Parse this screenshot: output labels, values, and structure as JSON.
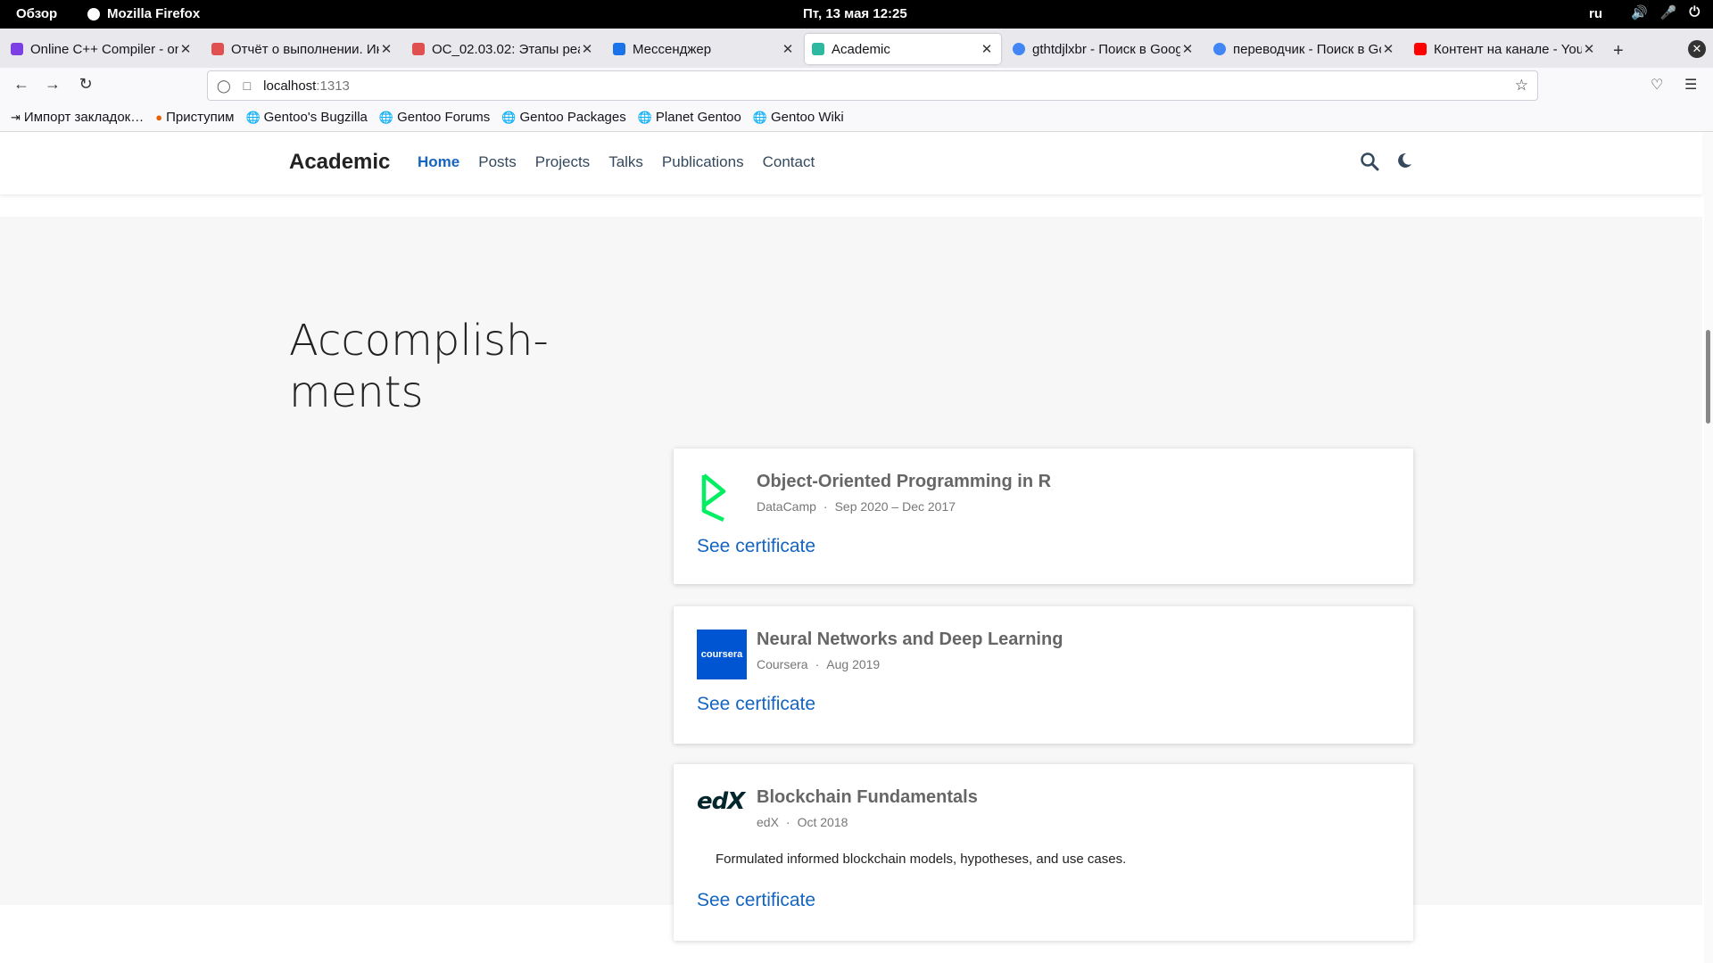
{
  "system": {
    "activities": "Обзор",
    "app": "Mozilla Firefox",
    "clock": "Пт, 13 мая  12:25",
    "lang": "ru"
  },
  "tabs": [
    {
      "label": "Online C++ Compiler - online",
      "color": "#7b3fe4"
    },
    {
      "label": "Отчёт о выполнении. Ин",
      "color": "#e05050"
    },
    {
      "label": "ОС_02.03.02: Этапы реа",
      "color": "#e05050"
    },
    {
      "label": "Мессенджер",
      "color": "#1a73e8"
    },
    {
      "label": "Academic",
      "color": "#2eb8a0"
    },
    {
      "label": "gthtdjlxbr - Поиск в Google",
      "color": "#4285f4"
    },
    {
      "label": "переводчик - Поиск в Google",
      "color": "#4285f4"
    },
    {
      "label": "Контент на канале - YouTube",
      "color": "#ff0000"
    }
  ],
  "url": {
    "host": "localhost",
    "port": ":1313"
  },
  "bookmarks": [
    {
      "label": "Импорт закладок…",
      "icon": "import-icon"
    },
    {
      "label": "Приступим",
      "icon": "firefox-icon"
    },
    {
      "label": "Gentoo's Bugzilla",
      "icon": "globe-icon"
    },
    {
      "label": "Gentoo Forums",
      "icon": "globe-icon"
    },
    {
      "label": "Gentoo Packages",
      "icon": "globe-icon"
    },
    {
      "label": "Planet Gentoo",
      "icon": "globe-icon"
    },
    {
      "label": "Gentoo Wiki",
      "icon": "globe-icon"
    }
  ],
  "site": {
    "brand": "Academic",
    "menu": [
      "Home",
      "Posts",
      "Projects",
      "Talks",
      "Publications",
      "Contact"
    ],
    "section_title": "Accomplish-ments",
    "accent": "#1565c0"
  },
  "accomplishments": [
    {
      "title": "Object-Oriented Programming in R",
      "org": "DataCamp",
      "date": "Sep 2020 – Dec 2017",
      "description": "",
      "link": "See certificate",
      "logo": "datacamp-logo"
    },
    {
      "title": "Neural Networks and Deep Learning",
      "org": "Coursera",
      "date": "Aug 2019",
      "description": "",
      "link": "See certificate",
      "logo": "coursera-logo",
      "logo_text": "coursera"
    },
    {
      "title": "Blockchain Fundamentals",
      "org": "edX",
      "date": "Oct 2018",
      "description": "Formulated informed blockchain models, hypotheses, and use cases.",
      "link": "See certificate",
      "logo": "edx-logo",
      "logo_text": "edX"
    }
  ]
}
